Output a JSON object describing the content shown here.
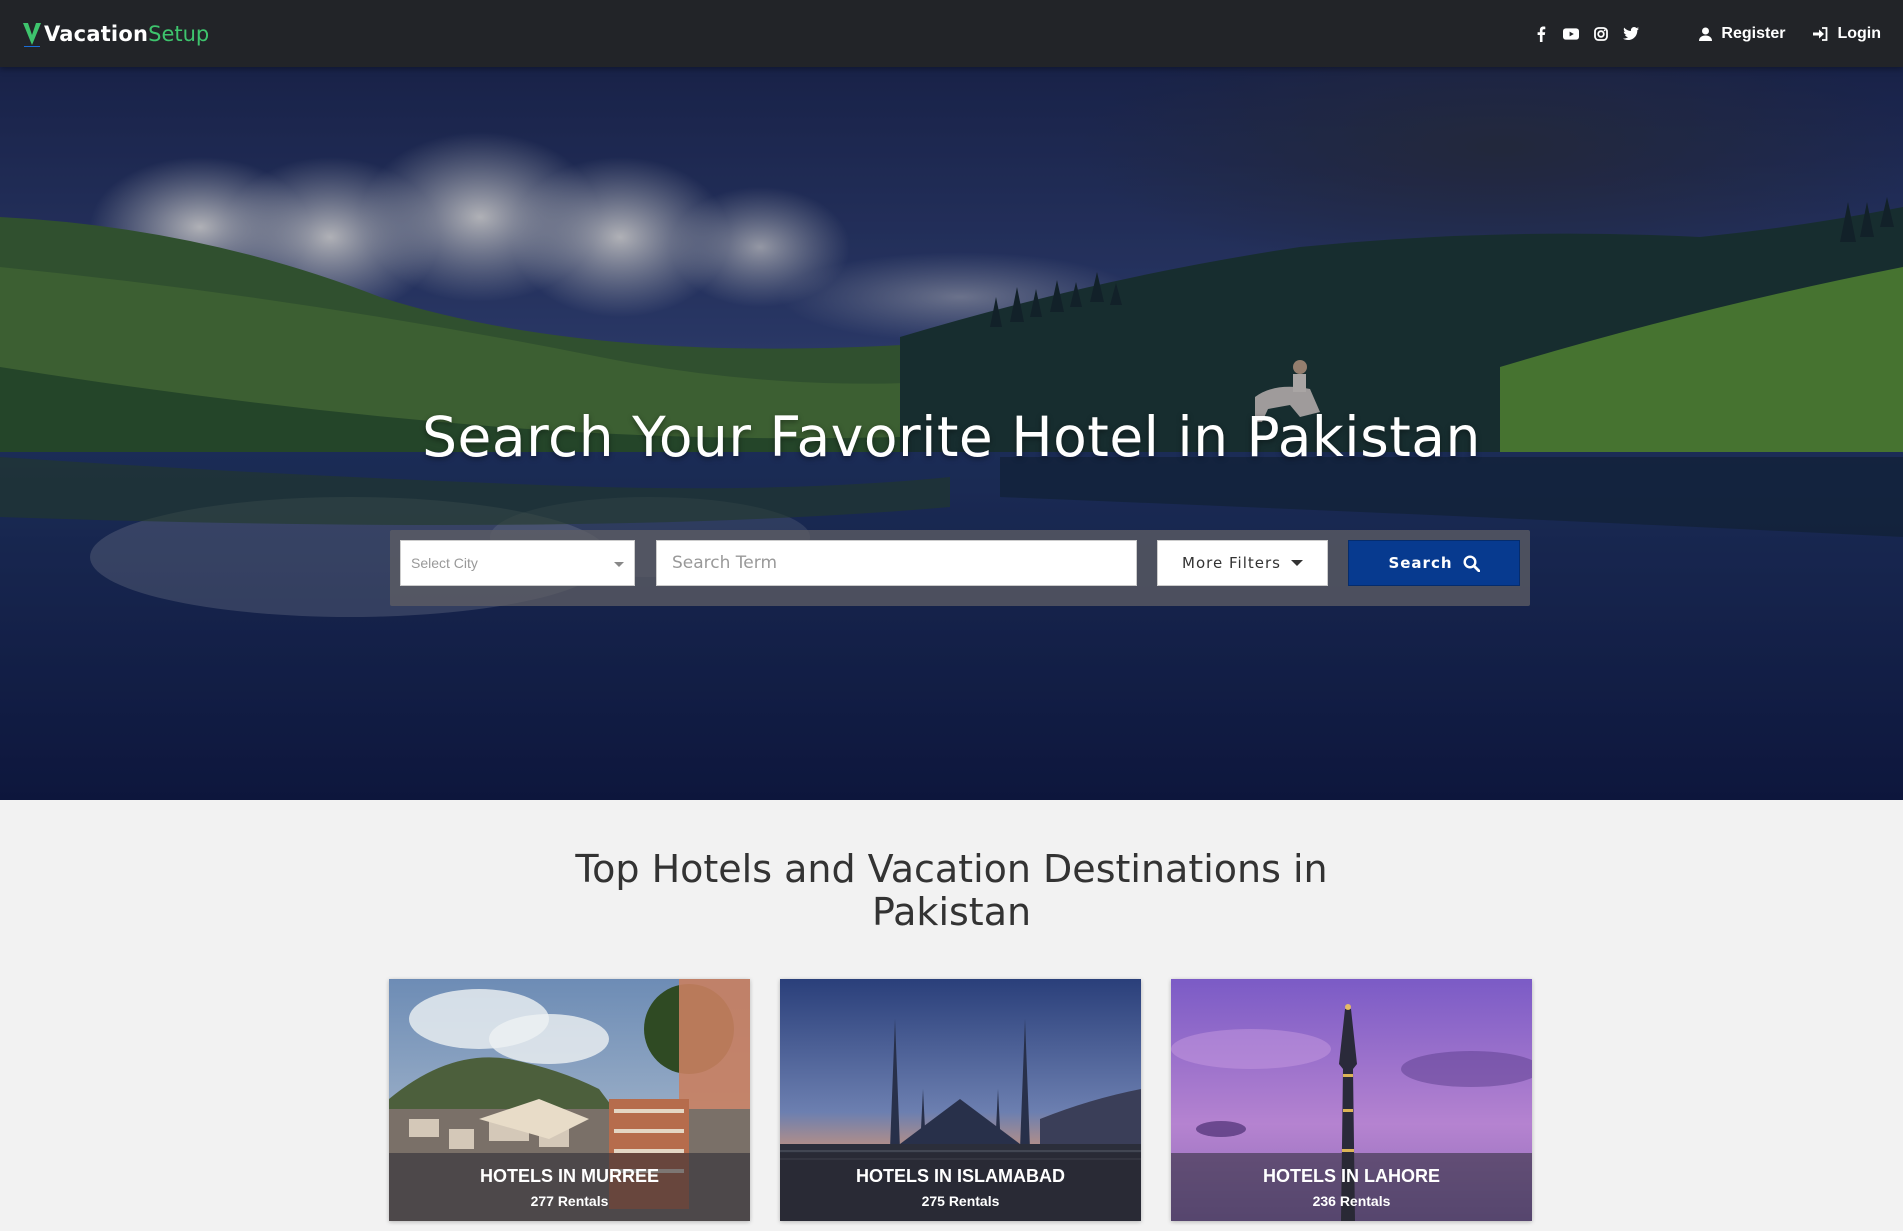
{
  "brand": {
    "name_part1": "Vacation",
    "name_part2": "Setup",
    "accent": "#3ec46d"
  },
  "nav": {
    "social_icons": [
      "facebook-icon",
      "youtube-icon",
      "instagram-icon",
      "twitter-icon"
    ],
    "register_label": "Register",
    "login_label": "Login"
  },
  "hero": {
    "title": "Search Your Favorite Hotel in Pakistan",
    "search": {
      "city_placeholder": "Select City",
      "term_placeholder": "Search Term",
      "filters_label": "More Filters",
      "search_label": "Search",
      "search_color": "#073a8f"
    }
  },
  "destinations": {
    "title_line1": "Top Hotels and Vacation Destinations in",
    "title_line2": "Pakistan",
    "cards": [
      {
        "title": "HOTELS IN MURREE",
        "subtitle": "277 Rentals"
      },
      {
        "title": "HOTELS IN ISLAMABAD",
        "subtitle": "275 Rentals"
      },
      {
        "title": "HOTELS IN LAHORE",
        "subtitle": "236 Rentals"
      }
    ]
  }
}
